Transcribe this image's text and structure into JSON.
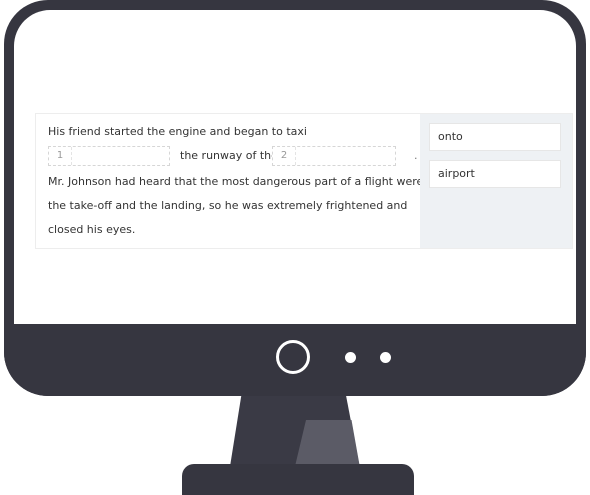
{
  "exercise": {
    "line1": "His friend started the engine and began to taxi",
    "blank1_number": "1",
    "middle_text": "the runway of the",
    "blank2_number": "2",
    "end_punct": ".",
    "line3": "Mr. Johnson had heard that the most dangerous part of a flight were",
    "line4": "the take-off and the landing, so he was extremely frightened and",
    "line5": "closed his eyes."
  },
  "options": [
    {
      "label": "onto"
    },
    {
      "label": "airport"
    }
  ],
  "colors": {
    "frame": "#363640",
    "options_panel": "#eef1f4",
    "text": "#333333"
  }
}
